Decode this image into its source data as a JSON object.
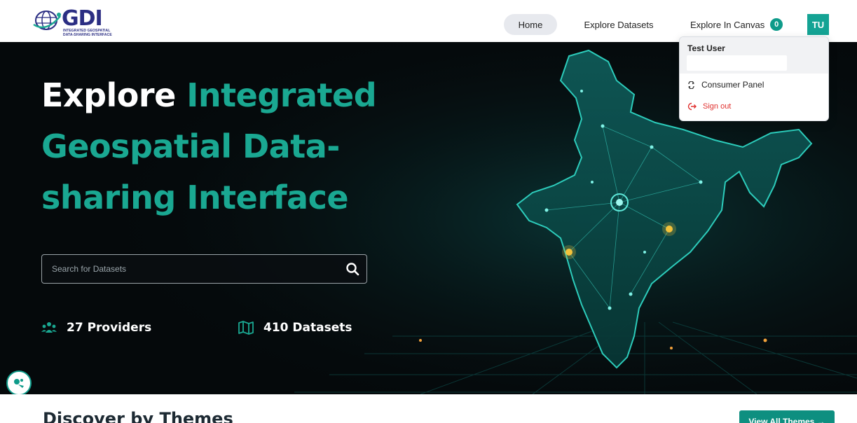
{
  "header": {
    "logo": {
      "wordmark": "GDI",
      "subtitle": "INTEGRATED GEOSPATIAL DATA-SHARING INTERFACE"
    },
    "nav": {
      "home": "Home",
      "explore_datasets": "Explore Datasets",
      "explore_canvas": "Explore In Canvas",
      "canvas_count": "0"
    },
    "avatar_initials": "TU"
  },
  "user_menu": {
    "name": "Test User",
    "consumer_panel": "Consumer Panel",
    "sign_out": "Sign out"
  },
  "hero": {
    "title_white": "Explore",
    "title_accent": "Integrated Geospatial Data-sharing Interface",
    "search_placeholder": "Search for Datasets",
    "stats": {
      "providers": "27 Providers",
      "datasets": "410 Datasets"
    }
  },
  "themes": {
    "title": "Discover by Themes",
    "view_all": "View All Themes →"
  },
  "colors": {
    "accent": "#1aa892",
    "brand_navy": "#2b2e83",
    "hero_bg": "#05090b",
    "danger": "#e0302e"
  },
  "icons": {
    "search": "search-icon",
    "providers": "users-icon",
    "datasets": "map-icon",
    "consumer_panel": "swap-icon",
    "sign_out": "sign-out-icon",
    "assistant": "assistant-icon"
  }
}
